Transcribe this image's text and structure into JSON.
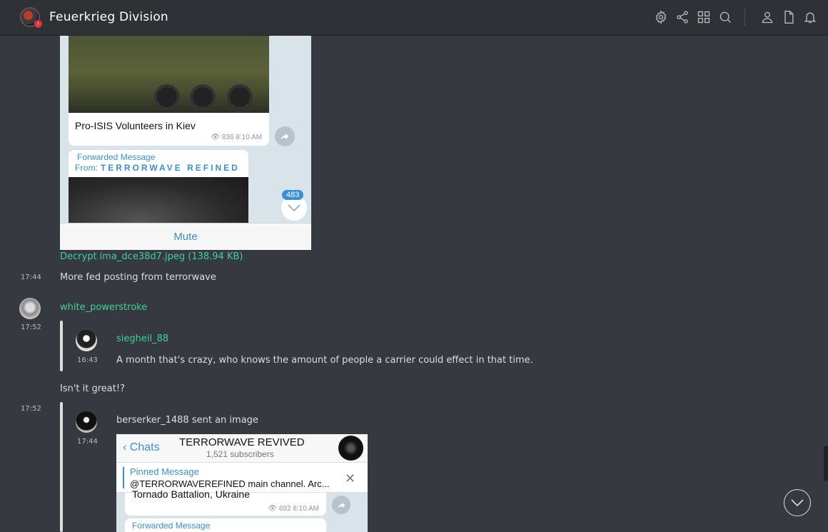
{
  "header": {
    "server_name": "Feuerkrieg Division",
    "badge": "!",
    "icons": [
      "gear-icon",
      "share-icon",
      "grid-icon",
      "search-icon",
      "user-icon",
      "document-icon",
      "bell-icon"
    ]
  },
  "messages": {
    "image_one": {
      "caption": "Pro-ISIS Volunteers in Kiev",
      "meta": "836 8:10 AM",
      "forwarded_label": "Forwarded Message",
      "forwarded_from_prefix": "From:",
      "forwarded_from": "TERRORWAVE REFINED",
      "unread_count": "483",
      "mute_label": "Mute"
    },
    "decrypt_link": "Decrypt ima_dce38d7.jpeg (138.94 KB)",
    "msg1": {
      "time": "17:44",
      "text": "More fed posting from terrorwave"
    },
    "msg2": {
      "time": "17:52",
      "user": "white_powerstroke",
      "quote_user": "siegheil_88",
      "quote_time": "16:43",
      "quote_text": "A month that's crazy, who knows the amount of people a carrier could effect in that time.",
      "reply": "Isn't it great!?"
    },
    "msg3": {
      "time": "17:52",
      "quote_time": "17:44",
      "quote_text": "berserker_1488 sent an image"
    },
    "image_two": {
      "back_label": "Chats",
      "channel_title": "TERRORWAVE REVIVED",
      "channel_subs": "1,521 subscribers",
      "pinned_label": "Pinned Message",
      "pinned_text": "@TERRORWAVEREFINED main channel. Arc...",
      "post_text": "Tornado Battalion, Ukraine",
      "post_meta": "692 8:10 AM",
      "forwarded_label": "Forwarded Message"
    }
  },
  "colors": {
    "background": "#36393f",
    "header": "#2f3136",
    "username": "#3ed29b",
    "telegram_blue": "#3a8fd6"
  }
}
